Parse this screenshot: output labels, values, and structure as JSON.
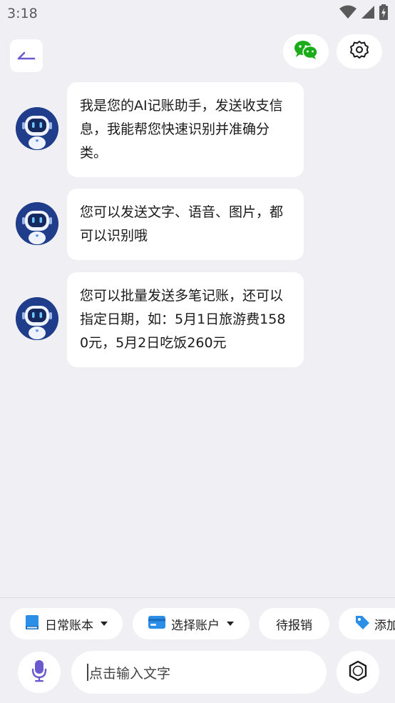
{
  "status_bar": {
    "time": "3:18",
    "icons": [
      "wifi-icon",
      "signal-icon",
      "battery-charging-icon"
    ]
  },
  "header": {
    "back_icon": "back-arrow-icon",
    "wechat_icon": "wechat-icon",
    "settings_icon": "gear-icon"
  },
  "messages": [
    {
      "sender": "assistant",
      "avatar_icon": "robot-avatar-icon",
      "text": "我是您的AI记账助手，发送收支信息，我能帮您快速识别并准确分类。"
    },
    {
      "sender": "assistant",
      "avatar_icon": "robot-avatar-icon",
      "text": "您可以发送文字、语音、图片，都可以识别哦"
    },
    {
      "sender": "assistant",
      "avatar_icon": "robot-avatar-icon",
      "text": "您可以批量发送多笔记账，还可以指定日期，如：5月1日旅游费1580元，5月2日吃饭260元"
    }
  ],
  "toolbar": {
    "ledger_label": "日常账本",
    "account_label": "选择账户",
    "reimburse_label": "待报销",
    "tag_label": "添加"
  },
  "input": {
    "placeholder": "点击输入文字",
    "mic_icon": "microphone-icon",
    "camera_icon": "camera-shutter-icon"
  },
  "colors": {
    "background": "#efeff4",
    "accent": "#6a5acd",
    "wechat_green": "#1aad19",
    "avatar_navy": "#1f3d8a",
    "card_blue": "#2b8fe8"
  }
}
